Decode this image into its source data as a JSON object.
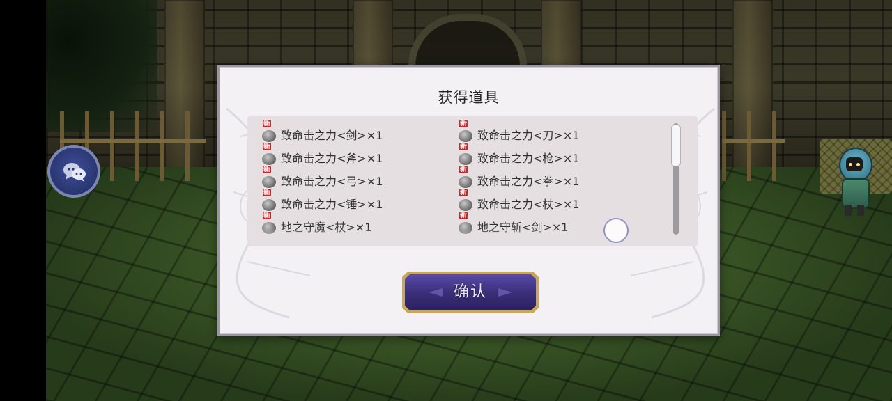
{
  "dialog": {
    "title": "获得道具",
    "confirm_label": "确认",
    "new_badge": "新",
    "items": [
      {
        "name": "致命击之力<剑>×1"
      },
      {
        "name": "致命击之力<刀>×1"
      },
      {
        "name": "致命击之力<斧>×1"
      },
      {
        "name": "致命击之力<枪>×1"
      },
      {
        "name": "致命击之力<弓>×1"
      },
      {
        "name": "致命击之力<拳>×1"
      },
      {
        "name": "致命击之力<锤>×1"
      },
      {
        "name": "致命击之力<杖>×1"
      },
      {
        "name": "地之守魔<杖>×1"
      },
      {
        "name": "地之守斩<剑>×1"
      }
    ]
  },
  "icons": {
    "chat": "chat-bubble-icon",
    "item": "stone-item-icon"
  },
  "colors": {
    "new_badge": "#c8282c",
    "confirm_button": "#3b2f7a",
    "confirm_border": "#c9a75a"
  }
}
